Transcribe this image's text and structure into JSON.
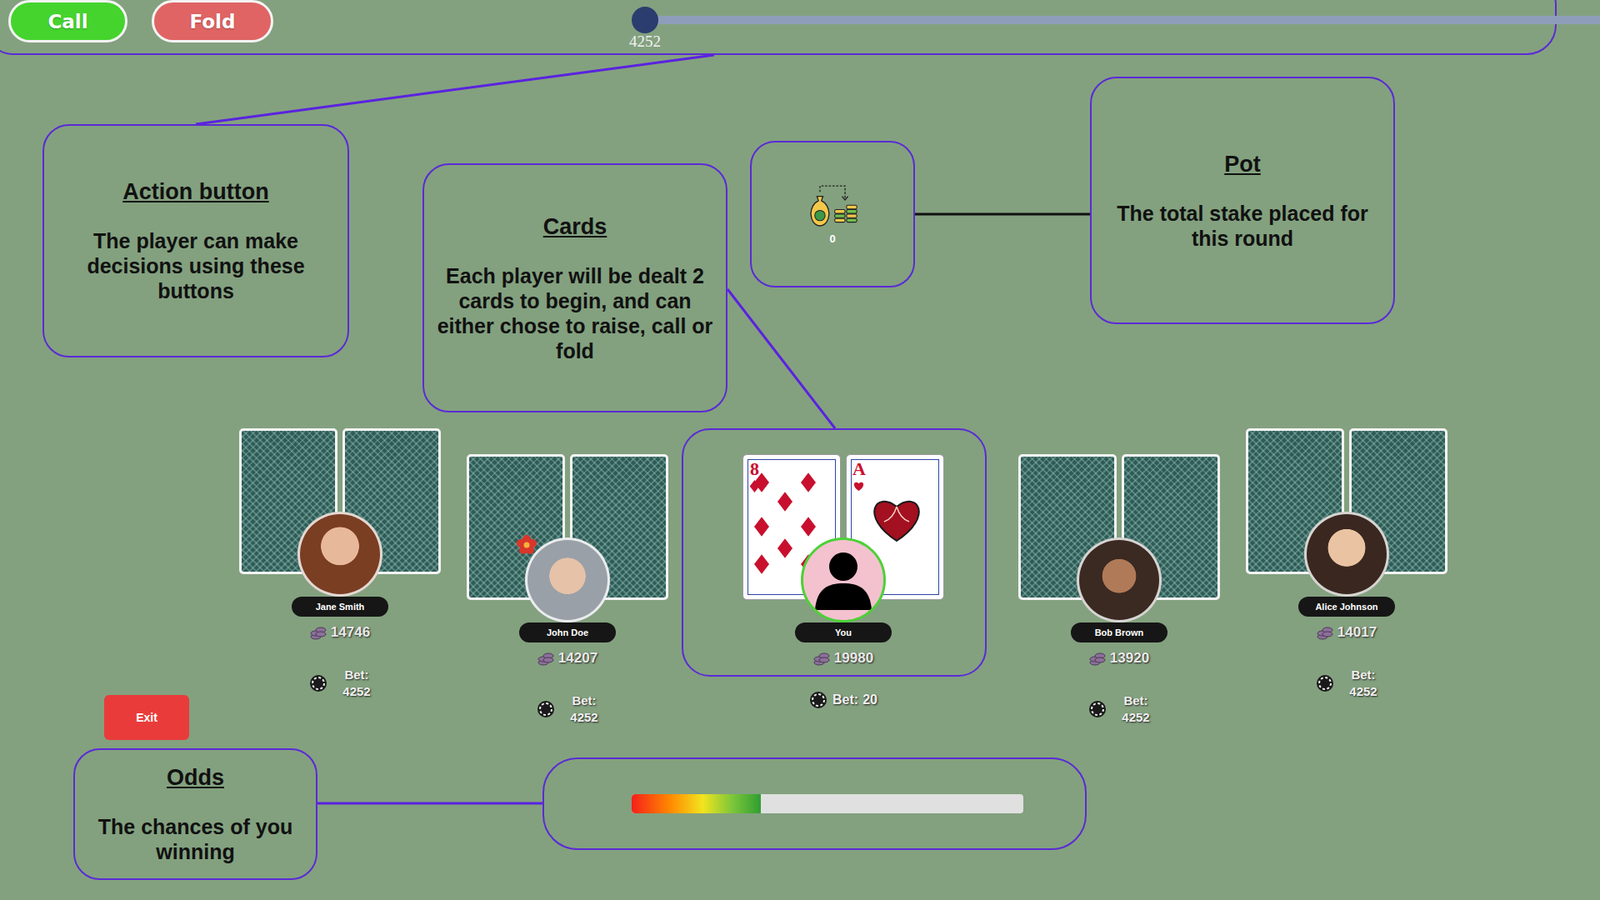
{
  "action_bar": {
    "buttons": [
      {
        "label": "Call",
        "color": "#45d42e"
      },
      {
        "label": "Fold",
        "color": "#e06464"
      }
    ],
    "bet_slider": {
      "level": 0,
      "reading": "4252"
    }
  },
  "callouts": [
    {
      "title": "Action button",
      "text": "The player can make decisions using these buttons"
    },
    {
      "title": "Cards",
      "text": "Each player will be dealt 2 cards to begin, and can either chose to raise, call or fold"
    },
    {
      "title": "Pot",
      "text": "The total stake placed for this round"
    },
    {
      "title": "Odds",
      "text": "The chances of you winning"
    }
  ],
  "pot": {
    "amount": "0"
  },
  "players": [
    {
      "name": "Jane Smith",
      "chips": "14746",
      "bet_label": "Bet:",
      "bet": "4252",
      "kind": "opponent",
      "active": false,
      "dealer": false,
      "cards": [
        {
          "face_up": false
        },
        {
          "face_up": false
        }
      ]
    },
    {
      "name": "John Doe",
      "chips": "14207",
      "bet_label": "Bet:",
      "bet": "4252",
      "kind": "opponent",
      "active": false,
      "dealer": true,
      "cards": [
        {
          "face_up": false
        },
        {
          "face_up": false
        }
      ]
    },
    {
      "name": "You",
      "chips": "19980",
      "bet_label": "Bet:",
      "bet": "20",
      "kind": "you",
      "active": true,
      "dealer": false,
      "cards": [
        {
          "face_up": true,
          "rank": "8",
          "suit": "diamonds"
        },
        {
          "face_up": true,
          "rank": "A",
          "suit": "hearts"
        }
      ]
    },
    {
      "name": "Bob Brown",
      "chips": "13920",
      "bet_label": "Bet:",
      "bet": "4252",
      "kind": "opponent",
      "active": false,
      "dealer": false,
      "cards": [
        {
          "face_up": false
        },
        {
          "face_up": false
        }
      ]
    },
    {
      "name": "Alice Johnson",
      "chips": "14017",
      "bet_label": "Bet:",
      "bet": "4252",
      "kind": "opponent",
      "active": false,
      "dealer": false,
      "cards": [
        {
          "face_up": false
        },
        {
          "face_up": false
        }
      ]
    }
  ],
  "exit_button": {
    "label": "Exit"
  },
  "odds": {
    "level": 0.33
  }
}
